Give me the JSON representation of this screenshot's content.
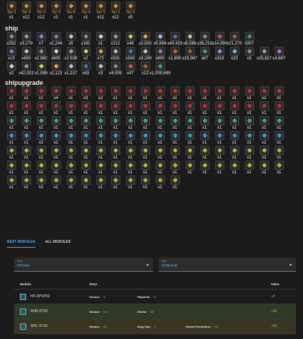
{
  "tiers": {
    "label": "Tier",
    "items": [
      {
        "tier": "3",
        "count": "x1",
        "color": "#d68a2a"
      },
      {
        "tier": "3",
        "count": "x12",
        "color": "#d68a2a"
      },
      {
        "tier": "3",
        "count": "x12",
        "color": "#d68a2a"
      },
      {
        "tier": "3",
        "count": "x1",
        "color": "#d68a2a"
      },
      {
        "tier": "4",
        "count": "x1",
        "color": "#d68a2a"
      },
      {
        "tier": "4",
        "count": "x1",
        "color": "#d68a2a"
      },
      {
        "tier": "3",
        "count": "x12",
        "color": "#d68a2a"
      },
      {
        "tier": "3",
        "count": "x12",
        "color": "#d68a2a"
      },
      {
        "tier": "3",
        "count": "x5",
        "color": "#d68a2a"
      }
    ]
  },
  "ship": {
    "title": "ship",
    "rows": [
      [
        "x252",
        "x3,279",
        "x7",
        "x1,244",
        "x5",
        "x161",
        "x1",
        "x212",
        "x48",
        "x2,500",
        "x5,994",
        "x40,429",
        "x6,086",
        "x36,215",
        "x14,090",
        "x21,270",
        "x307"
      ],
      [
        "x13",
        "x650",
        "x2,982",
        "x605",
        "x2,538",
        "x2",
        "x72",
        "x531",
        "x343",
        "x3,249",
        "x800",
        "x1,890",
        "x33,987",
        "x87",
        "x319",
        "x33",
        "x5",
        "x25,827",
        "x4,667"
      ],
      [
        "x2",
        "x42,022",
        "x1,089",
        "x2,122",
        "x1,217",
        "x43",
        "x3",
        "x4,009",
        "x47",
        "x12",
        "x1,000,699"
      ]
    ],
    "colors": [
      "#8a8a8a",
      "#7aa0c0",
      "#b070d0",
      "#6a8ab0",
      "#c0c0c0",
      "#8a8a8a",
      "#d0d0d0",
      "#9a9a9a",
      "#d0d050",
      "#e0a040",
      "#a0c0e0",
      "#4a70c0",
      "#c0c0c0",
      "#7a8aa0",
      "#d05050",
      "#a06040",
      "#40a060",
      "#9090d0",
      "#70b0d0"
    ]
  },
  "shipupgrade": {
    "title": "shipupgrade",
    "rows": [
      {
        "counts": [
          "x1",
          "x1",
          "x1",
          "x4",
          "x1",
          "x3",
          "x2",
          "x1",
          "x1",
          "x1",
          "x1",
          "x1",
          "x1",
          "x1",
          "x1",
          "x1",
          "x1",
          "x1",
          "x1"
        ],
        "color": "#c03030"
      },
      {
        "counts": [
          "x1",
          "x1",
          "x1",
          "x1",
          "x1",
          "x1",
          "x1",
          "x1",
          "x1",
          "x1",
          "x1",
          "x1",
          "x1",
          "x1",
          "x1",
          "x1",
          "x1",
          "x1",
          "x1"
        ],
        "color": "#c03030"
      },
      {
        "counts": [
          "x1",
          "x1",
          "x1",
          "x1",
          "x1",
          "x1",
          "x1",
          "x1",
          "x1",
          "x1",
          "x1",
          "x1",
          "x1",
          "x1",
          "x1",
          "x1",
          "x1",
          "x1",
          "x1"
        ],
        "color": "#30b070"
      },
      {
        "counts": [
          "x1",
          "x1",
          "x1",
          "x1",
          "x1",
          "x1",
          "x1",
          "x1",
          "x1",
          "x1",
          "x1",
          "x1",
          "x1",
          "x1",
          "x1",
          "x1",
          "x1",
          "x1",
          "x1"
        ],
        "color": "#30a0c0"
      },
      {
        "counts": [
          "x1",
          "x1",
          "x1",
          "x1",
          "x1",
          "x1",
          "x1",
          "x1",
          "x1",
          "x1",
          "x1",
          "x1",
          "x1",
          "x1",
          "x1",
          "x1",
          "x1",
          "x1",
          "x1"
        ],
        "color": "#c0b030"
      },
      {
        "counts": [
          "x1",
          "x1",
          "x1",
          "x1",
          "x1",
          "x1",
          "x1",
          "x1",
          "x1",
          "x1",
          "x1",
          "x1",
          "x1",
          "x1",
          "x1",
          "x1",
          "x1",
          "x1",
          "x1"
        ],
        "color": "#c0b030"
      },
      {
        "counts": [
          "x1",
          "x1",
          "x1",
          "x1",
          "x1",
          "x1",
          "x1",
          "x1",
          "x1",
          "x1",
          "x1",
          "x1"
        ],
        "color": "#c0b030"
      }
    ]
  },
  "tabs": {
    "best": "BEST MODULES",
    "all": "ALL MODULES"
  },
  "filters": {
    "ship_label": "Ship",
    "ship_value": "HYDRA",
    "stat_label": "Stat",
    "stat_value": "HONOUR"
  },
  "table": {
    "headers": {
      "module": "Module",
      "stats": "Stats",
      "value": "Value"
    },
    "rows": [
      {
        "name": "HP-ZPVP02",
        "stats": [
          {
            "k": "Honour:",
            "v": "+3",
            "t": "p"
          },
          {
            "k": "Hitpoints:",
            "v": "+4",
            "t": "p"
          }
        ],
        "value": "+3"
      },
      {
        "name": "SHD-XT10",
        "stats": [
          {
            "k": "Honour:",
            "v": "+10",
            "t": "p"
          },
          {
            "k": "Shield:",
            "v": "+10",
            "t": "p"
          }
        ],
        "value": "+10"
      },
      {
        "name": "SPC-XT10",
        "stats": [
          {
            "k": "Honour:",
            "v": "+10",
            "t": "p"
          },
          {
            "k": "Dmg %pc:",
            "v": "-4",
            "t": "n"
          },
          {
            "k": "Shield Penetration:",
            "v": "+13",
            "t": "p"
          }
        ],
        "value": "+10"
      }
    ]
  }
}
